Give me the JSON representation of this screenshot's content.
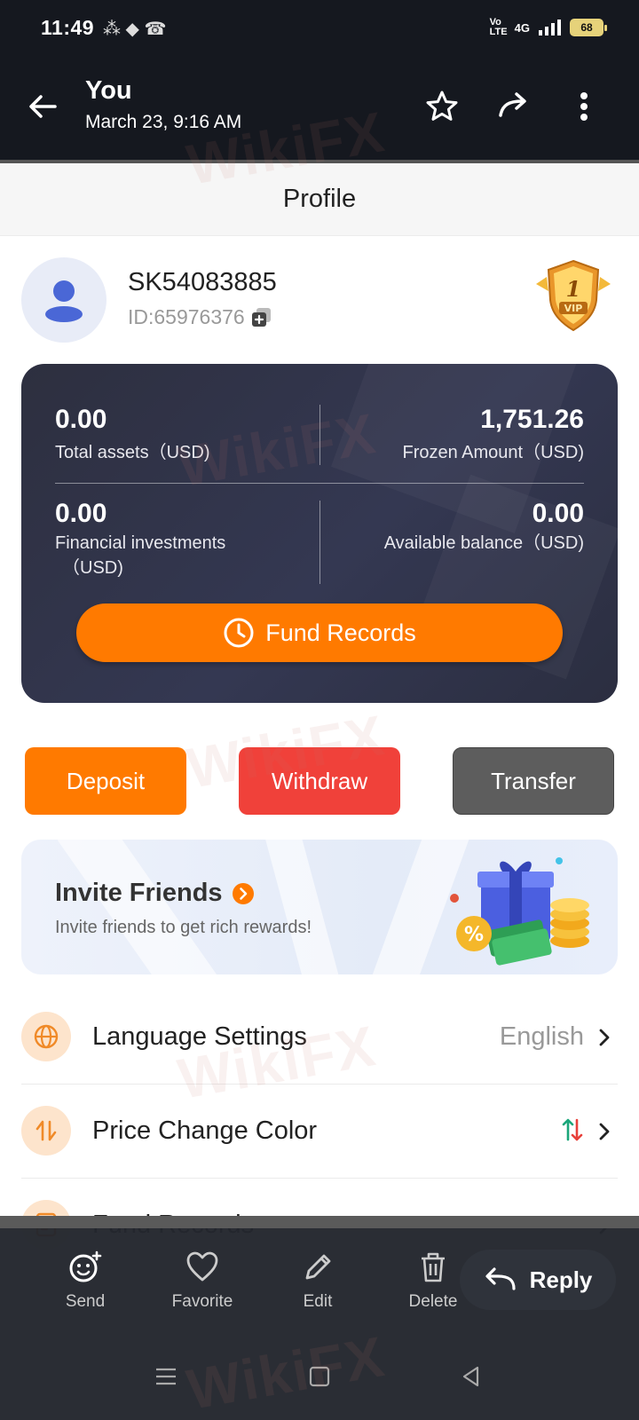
{
  "status_bar": {
    "time": "11:49",
    "network": "4G",
    "volte": "Vo LTE",
    "battery": "68"
  },
  "viewer": {
    "sender": "You",
    "date": "March 23, 9:16 AM"
  },
  "header": {
    "title": "Profile"
  },
  "profile": {
    "username": "SK54083885",
    "user_id": "ID:65976376",
    "vip_level": "1",
    "vip_text": "VIP"
  },
  "account_card": {
    "total_assets": {
      "value": "0.00",
      "label": "Total assets（USD)"
    },
    "frozen_amount": {
      "value": "1,751.26",
      "label": "Frozen Amount（USD)"
    },
    "financial_investments": {
      "value": "0.00",
      "label_line1": "Financial investments",
      "label_line2": "（USD)"
    },
    "available_balance": {
      "value": "0.00",
      "label": "Available balance（USD)"
    },
    "fund_records_button": "Fund Records"
  },
  "actions": {
    "deposit": "Deposit",
    "withdraw": "Withdraw",
    "transfer": "Transfer"
  },
  "invite": {
    "title": "Invite Friends",
    "subtitle": "Invite friends to get rich rewards!"
  },
  "menu": {
    "language": {
      "label": "Language Settings",
      "value": "English"
    },
    "price_color": {
      "label": "Price Change Color"
    },
    "fund_records": {
      "label": "Fund Records"
    }
  },
  "bottom_bar": {
    "send": "Send",
    "favorite": "Favorite",
    "edit": "Edit",
    "delete": "Delete",
    "reply": "Reply"
  },
  "watermark": "WikiFX",
  "colors": {
    "accent_orange": "#ff7a00",
    "withdraw_red": "#f0413a",
    "transfer_gray": "#5d5d5d",
    "card_dark": "#2d2f3f"
  }
}
